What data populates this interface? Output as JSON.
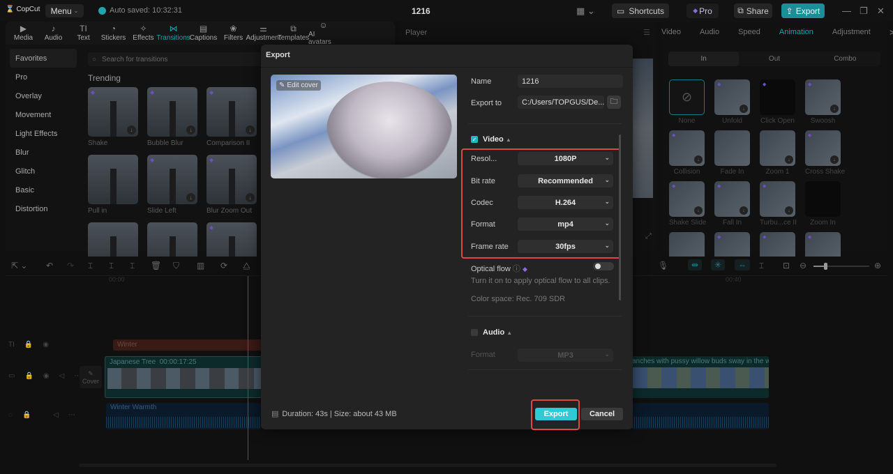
{
  "app": {
    "logo": "CopCut",
    "menu_label": "Menu",
    "autosave": "Auto saved: 10:32:31",
    "project_title": "1216",
    "shortcuts_label": "Shortcuts",
    "pro_label": "Pro",
    "share_label": "Share",
    "export_label": "Export"
  },
  "toolbar": [
    {
      "label": "Media",
      "icon": "media-icon",
      "glyph": "▶"
    },
    {
      "label": "Audio",
      "icon": "audio-icon",
      "glyph": "♪"
    },
    {
      "label": "Text",
      "icon": "text-icon",
      "glyph": "TI"
    },
    {
      "label": "Stickers",
      "icon": "stickers-icon",
      "glyph": "◔"
    },
    {
      "label": "Effects",
      "icon": "effects-icon",
      "glyph": "✧"
    },
    {
      "label": "Transitions",
      "icon": "transitions-icon",
      "glyph": "⋈",
      "active": true
    },
    {
      "label": "Captions",
      "icon": "captions-icon",
      "glyph": "▤"
    },
    {
      "label": "Filters",
      "icon": "filters-icon",
      "glyph": "❀"
    },
    {
      "label": "Adjustment",
      "icon": "adjustment-icon",
      "glyph": "⚌"
    },
    {
      "label": "Templates",
      "icon": "templates-icon",
      "glyph": "⧉"
    },
    {
      "label": "AI avatars",
      "icon": "ai-avatars-icon",
      "glyph": "☺"
    }
  ],
  "sidenav": {
    "favorites": "Favorites",
    "transitions": "Transitions",
    "items": [
      "Trending",
      "Pro",
      "Overlay",
      "Movement",
      "Light Effects",
      "Blur",
      "Glitch",
      "Basic",
      "Distortion"
    ]
  },
  "transitions_panel": {
    "search_placeholder": "Search for transitions",
    "section": "Trending",
    "items": [
      "Shake",
      "Bubble Blur",
      "Comparison II",
      "Pull in",
      "Slide Left",
      "Blur Zoom Out",
      "",
      "",
      ""
    ]
  },
  "player": {
    "title": "Player"
  },
  "right_panel": {
    "tabs": [
      "Video",
      "Audio",
      "Speed",
      "Animation",
      "Adjustment"
    ],
    "active_tab": "Animation",
    "segments": [
      "In",
      "Out",
      "Combo"
    ],
    "animations": [
      "None",
      "Unfold",
      "Click Open",
      "Swoosh",
      "Collision",
      "Fade In",
      "Zoom 1",
      "Cross Shake",
      "Shake Slide",
      "Fall In",
      "Turbu...ce II",
      "Zoom In",
      "",
      "",
      "",
      ""
    ]
  },
  "timeline": {
    "ruler_start": "00:00",
    "ruler_mid": "00:40",
    "text_clip": "Winter",
    "video_clip": "Japanese Tree",
    "video_clip_duration": "00:00:17:25",
    "video_clip2": "anches with pussy willow buds sway in the w",
    "audio_clip": "Winter Warmth",
    "cover_label": "Cover"
  },
  "export_dialog": {
    "title": "Export",
    "edit_cover": "Edit cover",
    "name_label": "Name",
    "name_value": "1216",
    "export_to_label": "Export to",
    "export_to_value": "C:/Users/TOPGUS/De...",
    "video_section": "Video",
    "video_checked": true,
    "settings": [
      {
        "label": "Resol...",
        "value": "1080P"
      },
      {
        "label": "Bit rate",
        "value": "Recommended"
      },
      {
        "label": "Codec",
        "value": "H.264"
      },
      {
        "label": "Format",
        "value": "mp4"
      },
      {
        "label": "Frame rate",
        "value": "30fps"
      }
    ],
    "optical_flow_label": "Optical flow",
    "optical_flow_on": false,
    "optical_flow_hint": "Turn it on to apply optical flow to all clips.",
    "color_space": "Color space: Rec. 709 SDR",
    "audio_section": "Audio",
    "audio_checked": false,
    "audio_format_label": "Format",
    "audio_format_value": "MP3",
    "footer_info": "Duration: 43s | Size: about 43 MB",
    "export_button": "Export",
    "cancel_button": "Cancel"
  }
}
